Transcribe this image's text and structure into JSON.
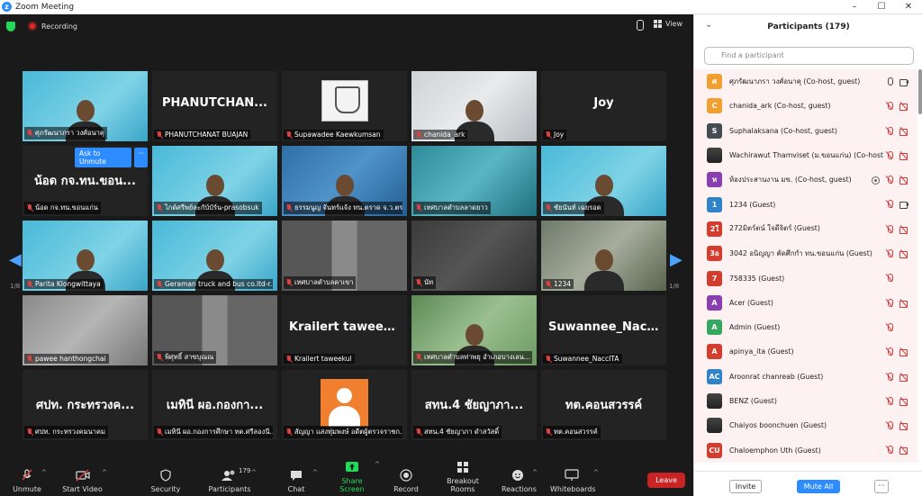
{
  "window": {
    "title": "Zoom Meeting",
    "controls": [
      "–",
      "☐",
      "✕"
    ]
  },
  "meeting": {
    "recording_label": "Recording",
    "view_label": "View",
    "page_left": "1/8",
    "page_right": "1/8",
    "unmute_overlay": {
      "ask_label": "Ask to Unmute",
      "more_label": "···"
    },
    "tiles": [
      {
        "name": "ศุภรัฒนาภรา วงศ์อนาคุ",
        "big": "",
        "style": "cyan",
        "person": true,
        "ita": true
      },
      {
        "name": "PHANUTCHANAT BUAJAN",
        "big": "PHANUTCHAN...",
        "style": "",
        "person": false
      },
      {
        "name": "Supawadee Kaewkumsan",
        "big": "",
        "style": "",
        "emblem": true
      },
      {
        "name": "chanida_ark",
        "big": "",
        "style": "pale",
        "person": true
      },
      {
        "name": "Joy",
        "big": "Joy",
        "style": "",
        "person": false
      },
      {
        "name": "น้อด กจ.ทน.ขอนแก่น",
        "big": "น้อด กจ.ทน.ขอน...",
        "style": "",
        "person": false
      },
      {
        "name": "ไกด์ศรีพย์ละกับ์บัร์น-prasobsuk",
        "big": "",
        "style": "cyan",
        "person": true
      },
      {
        "name": "ธรรมนูญ จันทร์แจ้ง ทน.ตราด จ.ว.ตราด",
        "big": "",
        "style": "blue",
        "person": true
      },
      {
        "name": "เทศบาลตำบลลาดยาว",
        "big": "",
        "style": "map",
        "person": false
      },
      {
        "name": "ชัยนันท์ เฉยรอด",
        "big": "",
        "style": "cyan",
        "person": true,
        "ita": true
      },
      {
        "name": "Parita Klongwittaya",
        "big": "",
        "style": "cyan",
        "person": true,
        "ita": true
      },
      {
        "name": "Geraman truck and bus co.ltd-r...",
        "big": "",
        "style": "cyan",
        "person": true
      },
      {
        "name": "เทศบาลตำบลคาเขา",
        "big": "",
        "style": "wall",
        "person": false
      },
      {
        "name": "นัท",
        "big": "",
        "style": "dark",
        "person": false
      },
      {
        "name": "1234",
        "big": "",
        "style": "room",
        "person": true
      },
      {
        "name": "pawee hanthongchai",
        "big": "",
        "style": "grey",
        "person": false
      },
      {
        "name": "พิศุทธิ์ สาขบุณณ",
        "big": "",
        "style": "wall",
        "person": false
      },
      {
        "name": "Krailert taweekul",
        "big": "Krailert taweekul",
        "style": "",
        "person": false
      },
      {
        "name": "เทศบาลตำบลท่าพยุ อำเภอบางเลน...",
        "big": "",
        "style": "green",
        "person": true
      },
      {
        "name": "Suwannee_NaccITA",
        "big": "Suwannee_Nacc...",
        "style": "",
        "person": false
      },
      {
        "name": "ศปท. กระทรวงคมนาคม",
        "big": "ศปท. กระทรวงค...",
        "style": "",
        "person": false
      },
      {
        "name": "เมทินี ผอ.กองการศึกษา ทต.ศรีลองนี...",
        "big": "เมทินี ผอ.กองกา...",
        "style": "",
        "person": false
      },
      {
        "name": "สัญญา แสงทุ่มพงษ์ อดีตผู้ตรวจราชก...",
        "big": "",
        "style": "",
        "avatar": true
      },
      {
        "name": "สทน.4 ชัยญาภา ดำสวัสดิ์",
        "big": "สทน.4 ชัยญาภา...",
        "style": "",
        "person": false
      },
      {
        "name": "ทต.คอนสวรรค์",
        "big": "ทต.คอนสวรรค์",
        "style": "",
        "person": false
      }
    ]
  },
  "toolbar": {
    "unmute": "Unmute",
    "start_video": "Start Video",
    "security": "Security",
    "participants": "Participants",
    "participants_count": "179",
    "chat": "Chat",
    "share_screen": "Share Screen",
    "record": "Record",
    "breakout_rooms": "Breakout Rooms",
    "reactions": "Reactions",
    "whiteboards": "Whiteboards",
    "leave": "Leave"
  },
  "participants_panel": {
    "title": "Participants (179)",
    "search_placeholder": "Find a participant",
    "invite": "Invite",
    "mute_all": "Mute All",
    "more": "···",
    "list": [
      {
        "avatar": "ศ",
        "color": "#f0a030",
        "name": "ศุภรัฒนาภรา วงศ์อนาคุ (Co-host, guest)",
        "mic": "on",
        "video": "on"
      },
      {
        "avatar": "C",
        "color": "#f0a030",
        "name": "chanida_ark (Co-host, guest)",
        "mic": "off",
        "video": "off"
      },
      {
        "avatar": "S",
        "color": "#444c54",
        "name": "Suphalaksana (Co-host, guest)",
        "mic": "off",
        "video": "off"
      },
      {
        "avatar": "",
        "color": "photo",
        "name": "Wachirawut Thamviset (ม.ขอนแก่น) (Co-host",
        "mic": "off",
        "video": "off"
      },
      {
        "avatar": "ห",
        "color": "#8a3fb0",
        "name": "ห้องประสานงาน มข. (Co-host, guest)",
        "mic": "off",
        "video": "off",
        "screen": true
      },
      {
        "avatar": "1",
        "color": "#2f83c8",
        "name": "1234 (Guest)",
        "mic": "off",
        "video": "on"
      },
      {
        "avatar": "2ใ",
        "color": "#d33d2e",
        "name": "272มิตร์ตน์ ใจดีจิตร์ (Guest)",
        "mic": "off",
        "video": "off"
      },
      {
        "avatar": "3อ",
        "color": "#d33d2e",
        "name": "3042 อนิญญา คัดศึกกำ ทน.ขอนแก่น (Guest)",
        "mic": "off",
        "video": "off"
      },
      {
        "avatar": "7",
        "color": "#d33d2e",
        "name": "758335 (Guest)",
        "mic": "off",
        "video": ""
      },
      {
        "avatar": "A",
        "color": "#8a3fb0",
        "name": "Acer (Guest)",
        "mic": "off",
        "video": "off"
      },
      {
        "avatar": "A",
        "color": "#35a860",
        "name": "Admin (Guest)",
        "mic": "off",
        "video": ""
      },
      {
        "avatar": "A",
        "color": "#d33d2e",
        "name": "apinya_ita (Guest)",
        "mic": "off",
        "video": "off"
      },
      {
        "avatar": "AC",
        "color": "#2f83c8",
        "name": "Aroonrat chanreab (Guest)",
        "mic": "off",
        "video": "off"
      },
      {
        "avatar": "",
        "color": "photo",
        "name": "BENZ (Guest)",
        "mic": "off",
        "video": "off"
      },
      {
        "avatar": "",
        "color": "photo",
        "name": "Chaiyos boonchuen (Guest)",
        "mic": "off",
        "video": "off"
      },
      {
        "avatar": "CU",
        "color": "#d33d2e",
        "name": "Chaloemphon Uth (Guest)",
        "mic": "off",
        "video": "off"
      }
    ]
  }
}
